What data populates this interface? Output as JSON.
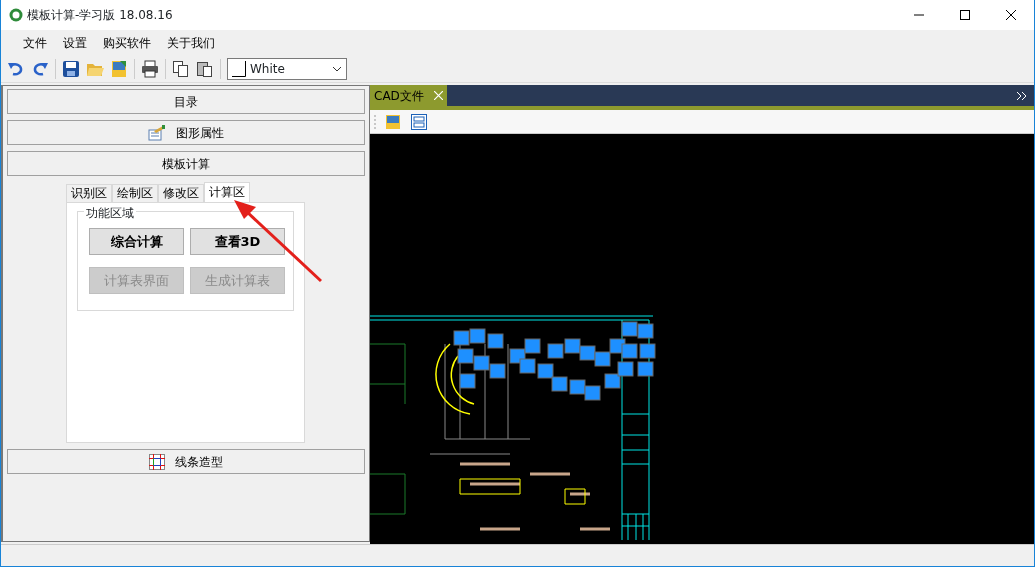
{
  "window": {
    "title": "模板计算-学习版 18.08.16"
  },
  "menu": [
    {
      "label": "文件"
    },
    {
      "label": "设置"
    },
    {
      "label": "购买软件"
    },
    {
      "label": "关于我们"
    }
  ],
  "toolbar": {
    "color_select": "White"
  },
  "panels": [
    {
      "label": "目录",
      "kind": "plain",
      "expanded": false
    },
    {
      "label": "图形属性",
      "kind": "properties",
      "expanded": false
    },
    {
      "label": "模板计算",
      "kind": "plain",
      "expanded": true
    },
    {
      "label": "线条造型",
      "kind": "grid",
      "expanded": false
    }
  ],
  "tabs": [
    {
      "label": "识别区",
      "selected": false
    },
    {
      "label": "绘制区",
      "selected": false
    },
    {
      "label": "修改区",
      "selected": false
    },
    {
      "label": "计算区",
      "selected": true
    }
  ],
  "group": {
    "title": "功能区域",
    "buttons": [
      {
        "label": "综合计算",
        "disabled": false
      },
      {
        "label": "查看3D",
        "disabled": false
      },
      {
        "label": "计算表界面",
        "disabled": true
      },
      {
        "label": "生成计算表",
        "disabled": true
      }
    ]
  },
  "document_tabs": [
    {
      "label": "CAD文件",
      "selected": true
    }
  ]
}
